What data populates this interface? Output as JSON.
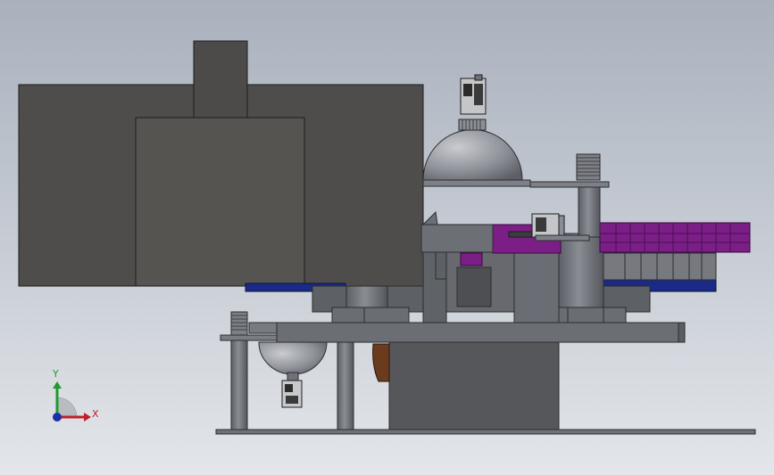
{
  "viewport": {
    "background_top": "#a9b1bd",
    "background_bottom": "#e3e6ea"
  },
  "triad": {
    "x_label": "X",
    "y_label": "Y",
    "x_color": "#c0202a",
    "y_color": "#1f9a2c",
    "z_color": "#1b2fa8"
  },
  "colors": {
    "body_dark": "#4e4d4b",
    "body_mid": "#595855",
    "steel": "#6f7278",
    "steel_light": "#8a8d93",
    "dome": "#9a9ca3",
    "purple": "#7b1f86",
    "navy": "#1a2a86",
    "wood": "#6b3b1e"
  }
}
